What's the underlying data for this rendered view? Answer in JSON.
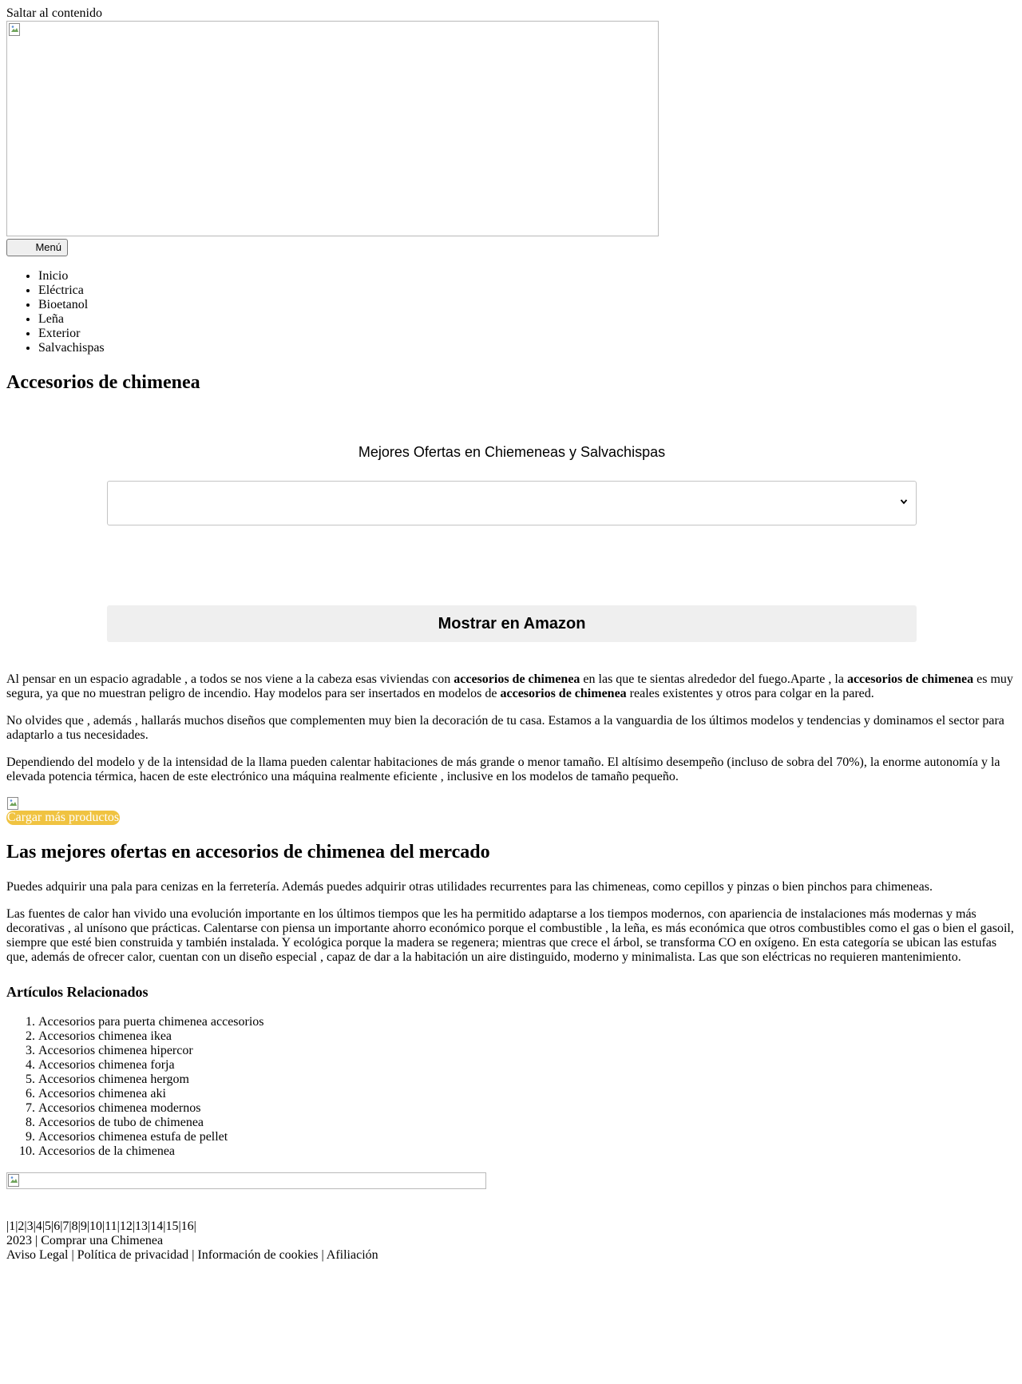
{
  "skip_link": "Saltar al contenido",
  "menu_button": "Menú",
  "nav": [
    "Inicio",
    "Eléctrica",
    "Bioetanol",
    "Leña",
    "Exterior",
    "Salvachispas"
  ],
  "page_title": "Accesorios de chimenea",
  "offers": {
    "title": "Mejores Ofertas en Chiemeneas y Salvachispas",
    "select_value": "",
    "button": "Mostrar en Amazon"
  },
  "intro": {
    "p1_a": "Al pensar en un espacio agradable , a todos se nos viene a la cabeza esas viviendas con ",
    "p1_b": "accesorios de chimenea",
    "p1_c": " en las que te sientas alrededor del fuego.Aparte , la ",
    "p1_d": "accesorios de chimenea",
    "p1_e": " es muy segura, ya que no muestran peligro de incendio. Hay modelos para ser insertados en modelos de ",
    "p1_f": "accesorios de chimenea",
    "p1_g": " reales existentes y otros para colgar en la pared.",
    "p2": "No olvides que , además , hallarás muchos diseños que complementen muy bien la decoración de tu casa. Estamos a la vanguardia de los últimos modelos y tendencias y dominamos el sector para adaptarlo a tus necesidades.",
    "p3": "Dependiendo del modelo y de la intensidad de la llama pueden calentar habitaciones de más grande o menor tamaño. El altísimo desempeño (incluso de sobra del 70%), la enorme autonomía y la elevada potencia térmica, hacen de este electrónico una máquina realmente eficiente , inclusive en los modelos de tamaño pequeño."
  },
  "load_more": "Cargar más productos",
  "load_more_color": "#f0c341",
  "section_title": "Las mejores ofertas en accesorios de chimenea del mercado",
  "section": {
    "p4": "Puedes adquirir una pala para cenizas en la ferretería. Además puedes adquirir otras utilidades recurrentes para las chimeneas, como cepillos y pinzas o bien pinchos para chimeneas.",
    "p5": "Las fuentes de calor han vivido una evolución importante en los últimos tiempos que les ha permitido adaptarse a los tiempos modernos, con apariencia de instalaciones más modernas y más decorativas , al unísono que prácticas. Calentarse con piensa un importante ahorro económico porque el combustible , la leña, es más económica que otros combustibles como el gas o bien el gasoil, siempre que esté bien construida y también instalada. Y ecológica porque la madera se regenera; mientras que crece el árbol, se transforma CO en oxígeno. En esta categoría se ubican las estufas que, además de ofrecer calor, cuentan con un diseño especial , capaz de dar a la habitación un aire distinguido, moderno y minimalista. Las que son eléctricas no requieren mantenimiento."
  },
  "related_title": "Artículos Relacionados",
  "related": [
    "Accesorios para puerta chimenea accesorios",
    "Accesorios chimenea ikea",
    "Accesorios chimenea hipercor",
    "Accesorios chimenea forja",
    "Accesorios chimenea hergom",
    "Accesorios chimenea aki",
    "Accesorios chimenea modernos",
    "Accesorios de tubo de chimenea",
    "Accesorios chimenea estufa de pellet",
    "Accesorios de la chimenea"
  ],
  "pages": [
    "1",
    "2",
    "3",
    "4",
    "5",
    "6",
    "7",
    "8",
    "9",
    "10",
    "11",
    "12",
    "13",
    "14",
    "15",
    "16"
  ],
  "footer": {
    "year": "2023",
    "site": "Comprar una Chimenea",
    "links": [
      "Aviso Legal",
      "Política de privacidad",
      "Información de cookies",
      "Afiliación"
    ]
  }
}
